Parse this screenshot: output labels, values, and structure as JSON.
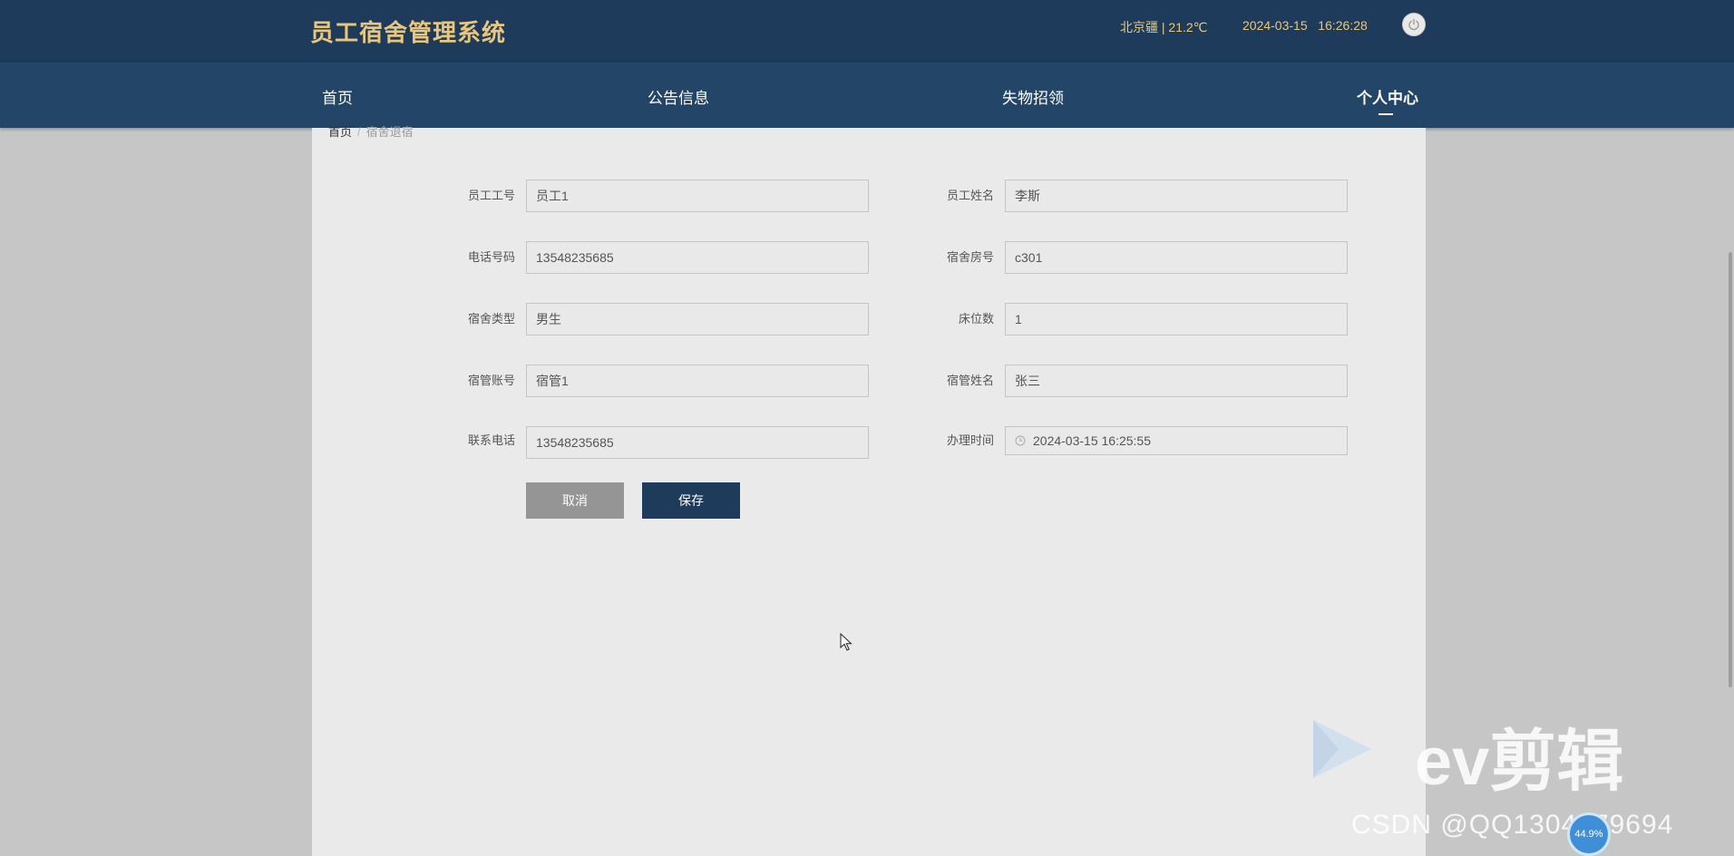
{
  "header": {
    "title": "员工宿舍管理系统",
    "weather": "北京疆 | 21.2℃",
    "datetime": "2024-03-15   16:26:28",
    "power_icon": "power-icon"
  },
  "nav": {
    "items": [
      {
        "label": "首页"
      },
      {
        "label": "公告信息"
      },
      {
        "label": "失物招领"
      },
      {
        "label": "个人中心"
      }
    ],
    "active": "个人中心"
  },
  "breadcrumb": {
    "home": "首页",
    "separator": "/",
    "current": "宿舍退宿"
  },
  "form": {
    "fields": [
      {
        "label": "员工工号",
        "value": "员工1"
      },
      {
        "label": "员工姓名",
        "value": "李斯"
      },
      {
        "label": "电话号码",
        "value": "13548235685"
      },
      {
        "label": "宿舍房号",
        "value": "c301"
      },
      {
        "label": "宿舍类型",
        "value": "男生"
      },
      {
        "label": "床位数",
        "value": "1"
      },
      {
        "label": "宿管账号",
        "value": "宿管1"
      },
      {
        "label": "宿管姓名",
        "value": "张三"
      },
      {
        "label": "联系电话",
        "value": "13548235685"
      },
      {
        "label": "办理时间",
        "value": "2024-03-15 16:25:55",
        "icon": "clock-icon"
      }
    ],
    "cancel_label": "取消",
    "save_label": "保存"
  },
  "watermark": {
    "ev_text": "ev剪辑",
    "csdn_text": "CSDN @QQ1304979694",
    "badge_text": "44.9%"
  },
  "colors": {
    "header_bg": "#1f3b5c",
    "nav_bg": "#234567",
    "title_gold": "#e8c77d",
    "save_button": "#1f3b5c",
    "cancel_button": "#959595"
  }
}
